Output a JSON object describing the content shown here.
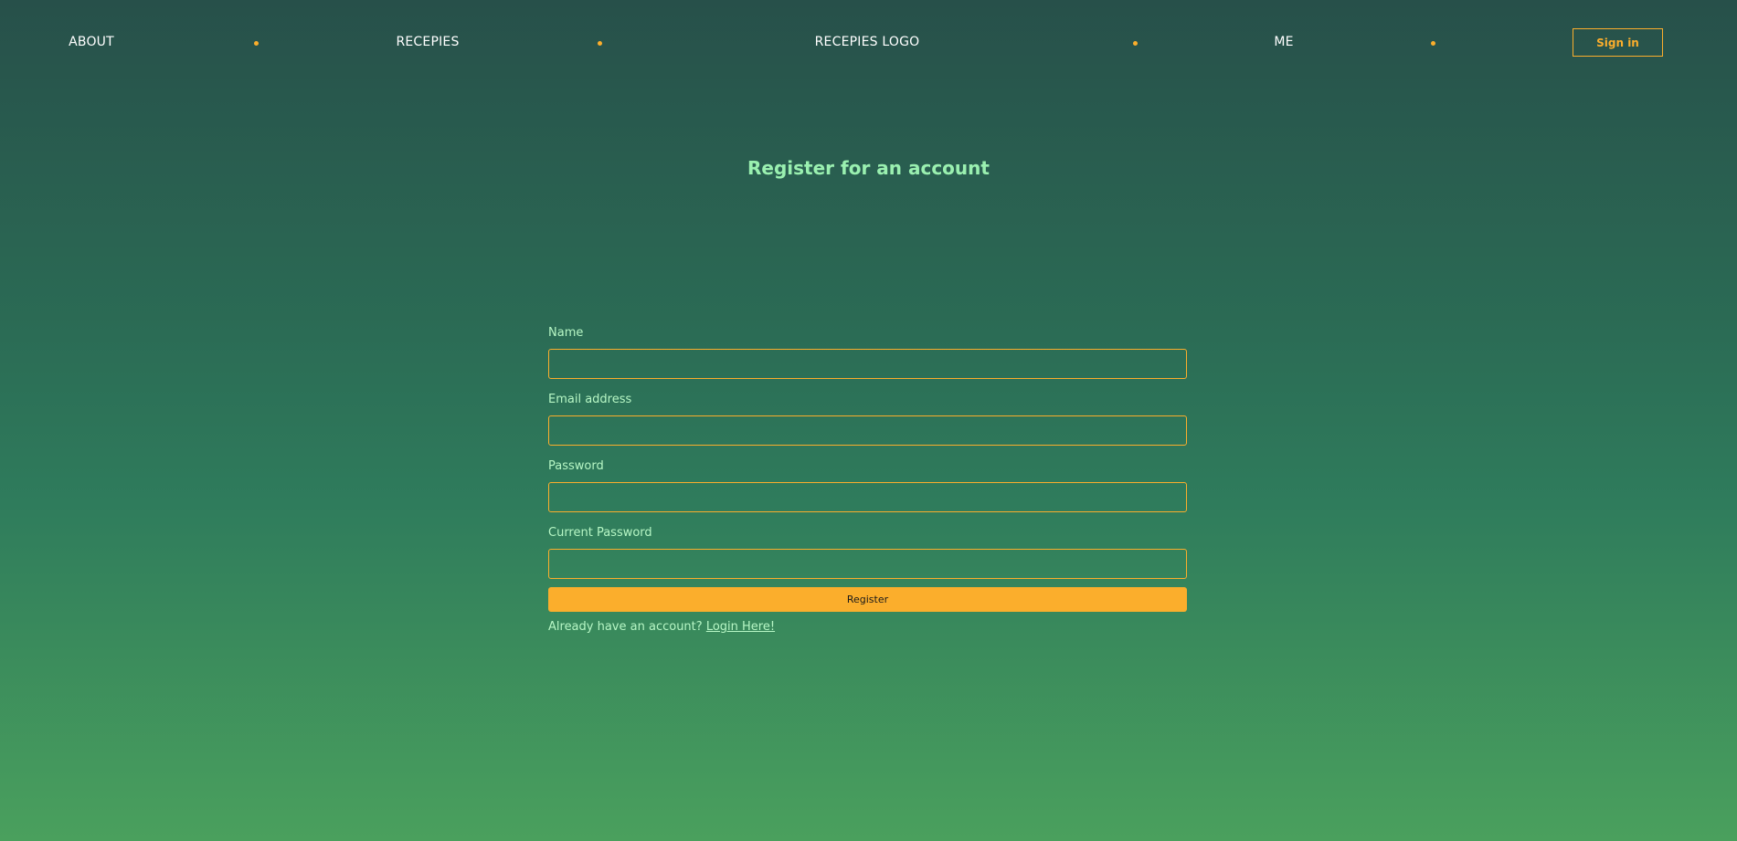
{
  "nav": {
    "about": "ABOUT",
    "recepies": "RECEPIES",
    "logo": "RECEPIES LOGO",
    "me": "ME",
    "sign_in": "Sign in"
  },
  "title": "Register for an account",
  "form": {
    "name_label": "Name",
    "name_value": "",
    "email_label": "Email address",
    "email_value": "",
    "password_label": "Password",
    "password_value": "",
    "current_password_label": "Current Password",
    "current_password_value": "",
    "register_label": "Register",
    "login_prompt": "Already have an account?",
    "login_link": "Login Here!"
  },
  "colors": {
    "accent": "#fbae2c",
    "label_text": "#b6f6c4",
    "title_text": "#9af0b0"
  }
}
